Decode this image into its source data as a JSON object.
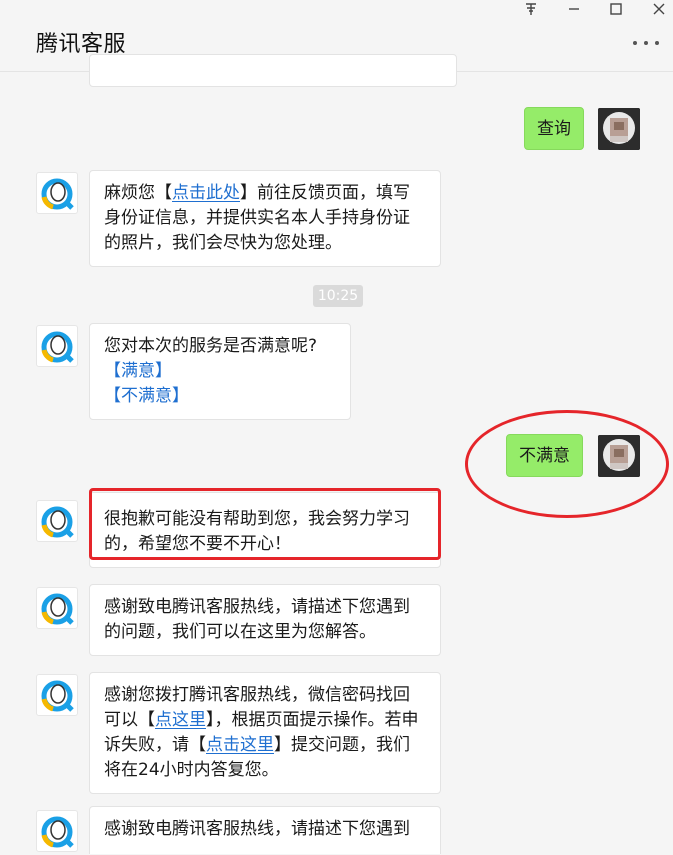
{
  "window": {
    "title": "腾讯客服",
    "controls": {
      "pin": "ᴴ",
      "minimize": "—",
      "maximize": "☐",
      "close": "✕"
    }
  },
  "chat": {
    "messages": [
      {
        "id": "m1",
        "from": "user",
        "text": "查询"
      },
      {
        "id": "m2",
        "from": "bot",
        "parts": [
          "麻烦您【",
          "点击此处",
          "】前往反馈页面，填写身份证信息，并提供实名本人手持身份证的照片，我们会尽快为您处理。"
        ]
      },
      {
        "id": "t1",
        "type": "time",
        "text": "10:25"
      },
      {
        "id": "m3",
        "from": "bot",
        "text": "您对本次的服务是否满意呢?",
        "options": [
          "【满意】",
          "【不满意】"
        ]
      },
      {
        "id": "m4",
        "from": "user",
        "text": "不满意"
      },
      {
        "id": "m5",
        "from": "bot",
        "text": "很抱歉可能没有帮助到您，我会努力学习的，希望您不要不开心！"
      },
      {
        "id": "m6",
        "from": "bot",
        "text": "感谢致电腾讯客服热线，请描述下您遇到的问题，我们可以在这里为您解答。"
      },
      {
        "id": "m7",
        "from": "bot",
        "parts": [
          "感谢您拨打腾讯客服热线，微信密码找回可以【",
          "点这里",
          "】，根据页面提示操作。若申诉失败，请【",
          "点击这里",
          "】提交问题，我们将在24小时内答复您。"
        ]
      },
      {
        "id": "m8",
        "from": "bot",
        "text": "感谢致电腾讯客服热线，请描述下您遇到"
      }
    ]
  },
  "colors": {
    "user_bubble": "#95ec69",
    "link": "#1f6fd0",
    "annotation": "#e5252a",
    "qq_blue": "#1aa0e6",
    "qq_yellow": "#f5b800"
  },
  "icons": {
    "bot_avatar": "qq-penguin-icon",
    "user_avatar": "blurred-user-avatar",
    "more": "more-dots-icon"
  }
}
